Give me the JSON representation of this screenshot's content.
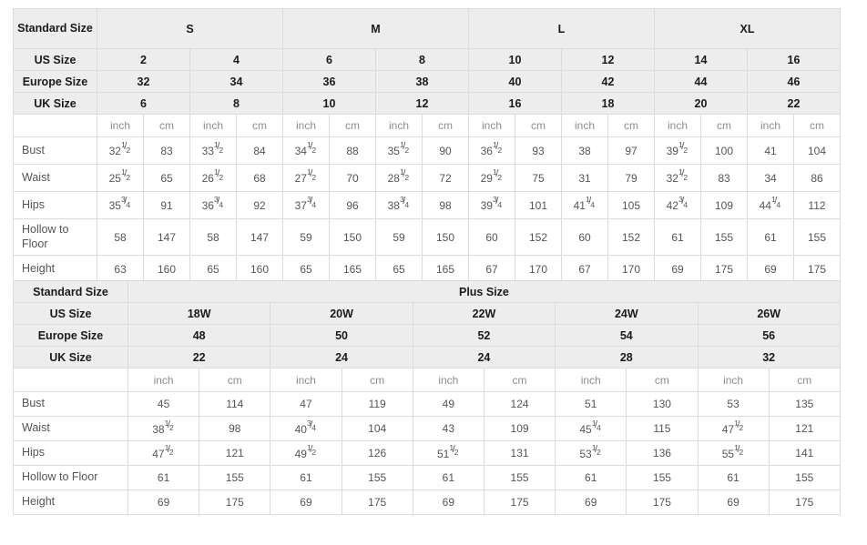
{
  "standard_table": {
    "row_label_header": "Standard Size",
    "size_groups": [
      {
        "label": "S",
        "cols": 2
      },
      {
        "label": "M",
        "cols": 2
      },
      {
        "label": "L",
        "cols": 2
      },
      {
        "label": "XL",
        "cols": 2
      }
    ],
    "spec_rows": [
      {
        "label": "US Size",
        "values": [
          "2",
          "4",
          "6",
          "8",
          "10",
          "12",
          "14",
          "16"
        ]
      },
      {
        "label": "Europe Size",
        "values": [
          "32",
          "34",
          "36",
          "38",
          "40",
          "42",
          "44",
          "46"
        ]
      },
      {
        "label": "UK Size",
        "values": [
          "6",
          "8",
          "10",
          "12",
          "16",
          "18",
          "20",
          "22"
        ]
      }
    ],
    "unit_row": {
      "label": "",
      "units": [
        "inch",
        "cm",
        "inch",
        "cm",
        "inch",
        "cm",
        "inch",
        "cm",
        "inch",
        "cm",
        "inch",
        "cm",
        "inch",
        "cm",
        "inch",
        "cm"
      ]
    },
    "measure_rows": [
      {
        "label": "Bust",
        "cells": [
          {
            "whole": "32",
            "num": "1",
            "den": "2"
          },
          {
            "whole": "83"
          },
          {
            "whole": "33",
            "num": "1",
            "den": "2"
          },
          {
            "whole": "84"
          },
          {
            "whole": "34",
            "num": "1",
            "den": "2"
          },
          {
            "whole": "88"
          },
          {
            "whole": "35",
            "num": "1",
            "den": "2"
          },
          {
            "whole": "90"
          },
          {
            "whole": "36",
            "num": "1",
            "den": "2"
          },
          {
            "whole": "93"
          },
          {
            "whole": "38"
          },
          {
            "whole": "97"
          },
          {
            "whole": "39",
            "num": "1",
            "den": "2"
          },
          {
            "whole": "100"
          },
          {
            "whole": "41"
          },
          {
            "whole": "104"
          }
        ]
      },
      {
        "label": "Waist",
        "cells": [
          {
            "whole": "25",
            "num": "1",
            "den": "2"
          },
          {
            "whole": "65"
          },
          {
            "whole": "26",
            "num": "1",
            "den": "2"
          },
          {
            "whole": "68"
          },
          {
            "whole": "27",
            "num": "1",
            "den": "2"
          },
          {
            "whole": "70"
          },
          {
            "whole": "28",
            "num": "1",
            "den": "2"
          },
          {
            "whole": "72"
          },
          {
            "whole": "29",
            "num": "1",
            "den": "2"
          },
          {
            "whole": "75"
          },
          {
            "whole": "31"
          },
          {
            "whole": "79"
          },
          {
            "whole": "32",
            "num": "1",
            "den": "2"
          },
          {
            "whole": "83"
          },
          {
            "whole": "34"
          },
          {
            "whole": "86"
          }
        ]
      },
      {
        "label": "Hips",
        "cells": [
          {
            "whole": "35",
            "num": "3",
            "den": "4"
          },
          {
            "whole": "91"
          },
          {
            "whole": "36",
            "num": "3",
            "den": "4"
          },
          {
            "whole": "92"
          },
          {
            "whole": "37",
            "num": "3",
            "den": "4"
          },
          {
            "whole": "96"
          },
          {
            "whole": "38",
            "num": "3",
            "den": "4"
          },
          {
            "whole": "98"
          },
          {
            "whole": "39",
            "num": "3",
            "den": "4"
          },
          {
            "whole": "101"
          },
          {
            "whole": "41",
            "num": "1",
            "den": "4"
          },
          {
            "whole": "105"
          },
          {
            "whole": "42",
            "num": "3",
            "den": "4"
          },
          {
            "whole": "109"
          },
          {
            "whole": "44",
            "num": "1",
            "den": "4"
          },
          {
            "whole": "112"
          }
        ]
      },
      {
        "label": "Hollow to Floor",
        "cells": [
          {
            "whole": "58"
          },
          {
            "whole": "147"
          },
          {
            "whole": "58"
          },
          {
            "whole": "147"
          },
          {
            "whole": "59"
          },
          {
            "whole": "150"
          },
          {
            "whole": "59"
          },
          {
            "whole": "150"
          },
          {
            "whole": "60"
          },
          {
            "whole": "152"
          },
          {
            "whole": "60"
          },
          {
            "whole": "152"
          },
          {
            "whole": "61"
          },
          {
            "whole": "155"
          },
          {
            "whole": "61"
          },
          {
            "whole": "155"
          }
        ]
      },
      {
        "label": "Height",
        "cells": [
          {
            "whole": "63"
          },
          {
            "whole": "160"
          },
          {
            "whole": "65"
          },
          {
            "whole": "160"
          },
          {
            "whole": "65"
          },
          {
            "whole": "165"
          },
          {
            "whole": "65"
          },
          {
            "whole": "165"
          },
          {
            "whole": "67"
          },
          {
            "whole": "170"
          },
          {
            "whole": "67"
          },
          {
            "whole": "170"
          },
          {
            "whole": "69"
          },
          {
            "whole": "175"
          },
          {
            "whole": "69"
          },
          {
            "whole": "175"
          }
        ]
      }
    ]
  },
  "plus_table": {
    "row_label_header": "Standard Size",
    "group_title": "Plus Size",
    "spec_rows": [
      {
        "label": "US Size",
        "values": [
          "18W",
          "20W",
          "22W",
          "24W",
          "26W"
        ]
      },
      {
        "label": "Europe Size",
        "values": [
          "48",
          "50",
          "52",
          "54",
          "56"
        ]
      },
      {
        "label": "UK Size",
        "values": [
          "22",
          "24",
          "24",
          "28",
          "32"
        ]
      }
    ],
    "unit_row": {
      "label": "",
      "units": [
        "inch",
        "cm",
        "inch",
        "cm",
        "inch",
        "cm",
        "inch",
        "cm",
        "inch",
        "cm"
      ]
    },
    "measure_rows": [
      {
        "label": "Bust",
        "cells": [
          {
            "whole": "45"
          },
          {
            "whole": "114"
          },
          {
            "whole": "47"
          },
          {
            "whole": "119"
          },
          {
            "whole": "49"
          },
          {
            "whole": "124"
          },
          {
            "whole": "51"
          },
          {
            "whole": "130"
          },
          {
            "whole": "53"
          },
          {
            "whole": "135"
          }
        ]
      },
      {
        "label": "Waist",
        "cells": [
          {
            "whole": "38",
            "num": "1",
            "den": "2"
          },
          {
            "whole": "98"
          },
          {
            "whole": "40",
            "num": "3",
            "den": "4"
          },
          {
            "whole": "104"
          },
          {
            "whole": "43"
          },
          {
            "whole": "109"
          },
          {
            "whole": "45",
            "num": "1",
            "den": "4"
          },
          {
            "whole": "115"
          },
          {
            "whole": "47",
            "num": "1",
            "den": "2"
          },
          {
            "whole": "121"
          }
        ]
      },
      {
        "label": "Hips",
        "cells": [
          {
            "whole": "47",
            "num": "1",
            "den": "2"
          },
          {
            "whole": "121"
          },
          {
            "whole": "49",
            "num": "1",
            "den": "2"
          },
          {
            "whole": "126"
          },
          {
            "whole": "51",
            "num": "1",
            "den": "2"
          },
          {
            "whole": "131"
          },
          {
            "whole": "53",
            "num": "1",
            "den": "2"
          },
          {
            "whole": "136"
          },
          {
            "whole": "55",
            "num": "1",
            "den": "2"
          },
          {
            "whole": "141"
          }
        ]
      },
      {
        "label": "Hollow to Floor",
        "cells": [
          {
            "whole": "61"
          },
          {
            "whole": "155"
          },
          {
            "whole": "61"
          },
          {
            "whole": "155"
          },
          {
            "whole": "61"
          },
          {
            "whole": "155"
          },
          {
            "whole": "61"
          },
          {
            "whole": "155"
          },
          {
            "whole": "61"
          },
          {
            "whole": "155"
          }
        ]
      },
      {
        "label": "Height",
        "cells": [
          {
            "whole": "69"
          },
          {
            "whole": "175"
          },
          {
            "whole": "69"
          },
          {
            "whole": "175"
          },
          {
            "whole": "69"
          },
          {
            "whole": "175"
          },
          {
            "whole": "69"
          },
          {
            "whole": "175"
          },
          {
            "whole": "69"
          },
          {
            "whole": "175"
          }
        ]
      }
    ]
  },
  "colors": {
    "header_bg": "#ededed",
    "border": "#dcdcdc",
    "body_text": "#555555",
    "header_text": "#1a1a1a",
    "unit_text": "#8d8d8d",
    "page_bg": "#ffffff"
  }
}
